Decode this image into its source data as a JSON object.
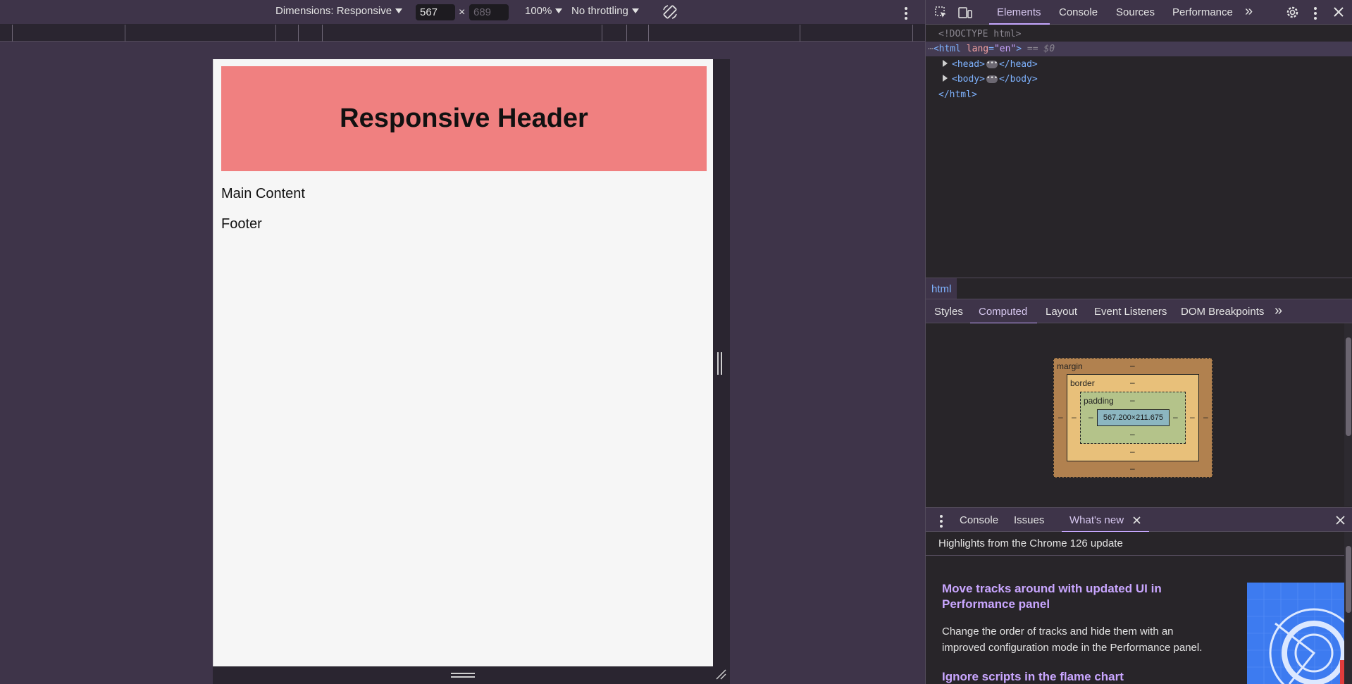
{
  "device_toolbar": {
    "dimensions_label": "Dimensions: Responsive",
    "width_value": "567",
    "height_placeholder": "689",
    "zoom": "100%",
    "throttling": "No throttling",
    "size_separator": "×"
  },
  "page": {
    "header_title": "Responsive Header",
    "main_content": "Main Content",
    "footer": "Footer"
  },
  "devtools": {
    "tabs": [
      "Elements",
      "Console",
      "Sources",
      "Performance"
    ],
    "active_tab": "Elements",
    "more_tabs_glyph": "»",
    "tree": {
      "doctype": "<!DOCTYPE html>",
      "html_open": "<html",
      "attr_name": "lang",
      "attr_value": "\"en\"",
      "selected_suffix": "== $0",
      "head_open": "<head>",
      "head_close": "</head>",
      "body_open": "<body>",
      "body_close": "</body>",
      "html_close": "</html>"
    },
    "breadcrumb": "html",
    "sub_tabs": [
      "Styles",
      "Computed",
      "Layout",
      "Event Listeners",
      "DOM Breakpoints"
    ],
    "active_sub_tab": "Computed",
    "box_model": {
      "margin_label": "margin",
      "border_label": "border",
      "padding_label": "padding",
      "content_size": "567.200×211.675",
      "dash": "–"
    },
    "drawer": {
      "tabs": [
        "Console",
        "Issues",
        "What's new"
      ],
      "active_tab": "What's new",
      "highlights": "Highlights from the Chrome 126 update",
      "item1_title_line1": "Move tracks around with updated UI in",
      "item1_title_line2": "Performance panel",
      "item1_text_line1": "Change the order of tracks and hide them with an",
      "item1_text_line2": "improved configuration mode in the Performance panel.",
      "item2_title": "Ignore scripts in the flame chart"
    }
  },
  "colors": {
    "header_bg": "#f08080",
    "accent": "#c6a8ff",
    "toolbar_bg": "#3e3449",
    "panel_bg": "#282529"
  }
}
